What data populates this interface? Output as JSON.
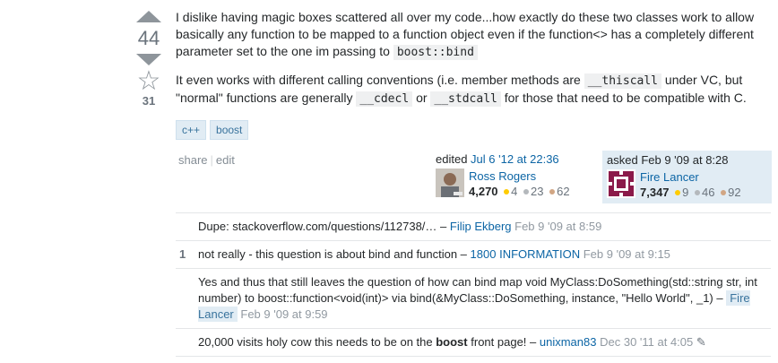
{
  "question": {
    "score": "44",
    "favorite_count": "31",
    "paragraphs": [
      {
        "text1": "I dislike having magic boxes scattered all over my code...how exactly do these two classes work to allow basically any function to be mapped to a function object even if the function<> has a completely different parameter set to the one im passing to",
        "code1": "boost::bind"
      },
      {
        "text1": "It even works with different calling conventions (i.e. member methods are",
        "code1": "__thiscall",
        "text2": "under VC, but \"normal\" functions are generally",
        "code2": "__cdecl",
        "text3": "or",
        "code3": "__stdcall",
        "text4": "for those that need to be compatible with C."
      }
    ],
    "tags": [
      "c++",
      "boost"
    ],
    "menu": {
      "share": "share",
      "edit": "edit"
    },
    "edited": {
      "label": "edited",
      "time": "Jul 6 '12 at 22:36",
      "user": "Ross Rogers",
      "rep": "4,270",
      "gold": "4",
      "silver": "23",
      "bronze": "62"
    },
    "asked": {
      "label": "asked",
      "time": "Feb 9 '09 at 8:28",
      "user": "Fire Lancer",
      "rep": "7,347",
      "gold": "9",
      "silver": "46",
      "bronze": "92"
    }
  },
  "comments": [
    {
      "score": "",
      "text": "Dupe: stackoverflow.com/questions/112738/… –",
      "user": "Filip Ekberg",
      "date": "Feb 9 '09 at 8:59"
    },
    {
      "score": "1",
      "text": "not really - this question is about bind and function –",
      "user": "1800 INFORMATION",
      "date": "Feb 9 '09 at 9:15"
    },
    {
      "score": "",
      "text": "Yes and thus that still leaves the question of how can bind map void MyClass:DoSomething(std::string str, int number) to boost::function<void(int)> via bind(&MyClass::DoSomething, instance, \"Hello World\", _1) –",
      "user": "Fire Lancer",
      "date": "Feb 9 '09 at 9:59"
    },
    {
      "score": "",
      "text1": "20,000 visits holy cow this needs to be on the",
      "bold": "boost",
      "text2": "front page! –",
      "user": "unixman83",
      "date": "Dec 30 '11 at 4:05"
    }
  ]
}
